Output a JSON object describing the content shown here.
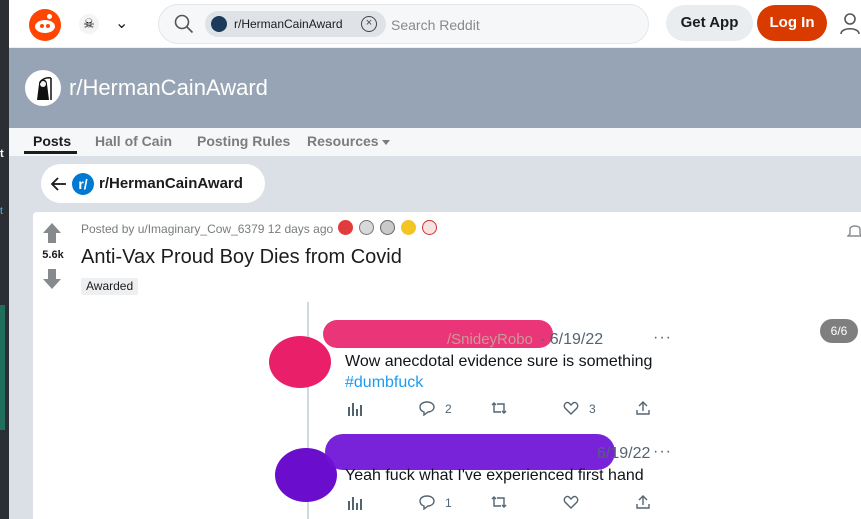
{
  "header": {
    "search_chip": "r/HermanCainAward",
    "search_placeholder": "Search Reddit",
    "get_app": "Get App",
    "log_in": "Log In"
  },
  "banner": {
    "title": "r/HermanCainAward"
  },
  "tabs": [
    {
      "label": "Posts",
      "active": true
    },
    {
      "label": "Hall of Cain"
    },
    {
      "label": "Posting Rules"
    },
    {
      "label": "Resources"
    }
  ],
  "back_pill": {
    "badge": "r/",
    "label": "r/HermanCainAward"
  },
  "post": {
    "votes": "5.6k",
    "meta": "Posted by u/Imaginary_Cow_6379 12 days ago",
    "title": "Anti-Vax Proud Boy Dies from Covid",
    "flair": "Awarded",
    "gallery_count": "6/6",
    "tweets": [
      {
        "handle_partial": "/SnideyRobo",
        "date": "· 6/19/22",
        "text": "Wow anecdotal evidence sure is something",
        "hashtag": "#dumbfuck",
        "replies": "2",
        "likes": "3"
      },
      {
        "date": "6/19/22",
        "text": "Yeah fuck what I've experienced first hand",
        "replies": "1"
      }
    ]
  },
  "colors": {
    "reddit_orange": "#ff4500",
    "login_red": "#d93a00",
    "banner_bg": "#97a4b5",
    "page_bg": "#dae0e6",
    "link_blue": "#1d9bf0"
  }
}
